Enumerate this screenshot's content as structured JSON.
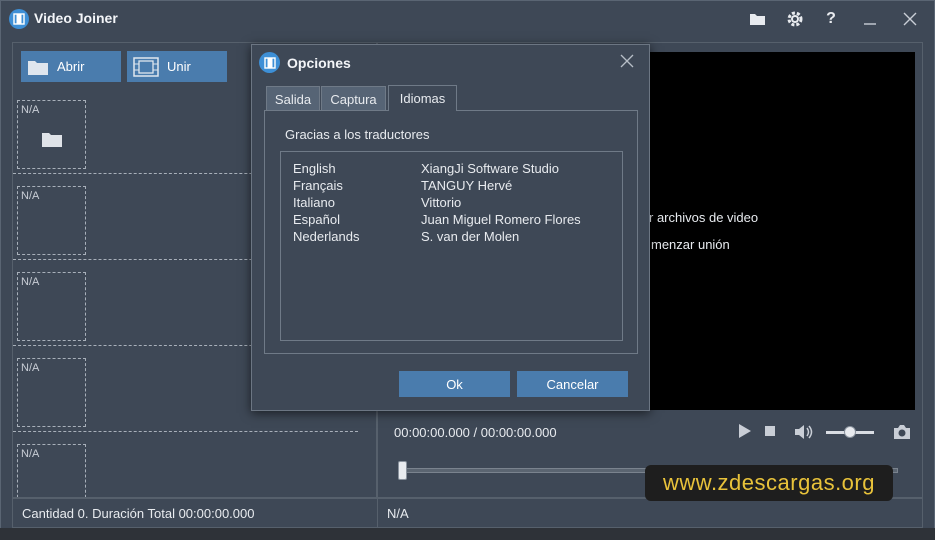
{
  "app": {
    "title": "Video Joiner",
    "icons": [
      "film-icon",
      "folder-icon",
      "gear-icon",
      "help-icon",
      "minimize-icon",
      "close-icon"
    ]
  },
  "toolbar": {
    "open_label": "Abrir",
    "join_label": "Unir"
  },
  "clips": [
    {
      "label": "N/A"
    },
    {
      "label": "N/A"
    },
    {
      "label": "N/A"
    },
    {
      "label": "N/A"
    },
    {
      "label": "N/A"
    }
  ],
  "preview": {
    "hint_1": "r archivos de video",
    "hint_2": "menzar unión",
    "time": "00:00:00.000 / 00:00:00.000",
    "volume": 0.5,
    "seek": 0
  },
  "status": {
    "summary": "Cantidad 0. Duración Total 00:00:00.000",
    "right": "N/A"
  },
  "dialog": {
    "title": "Opciones",
    "tabs": [
      {
        "label": "Salida",
        "active": false
      },
      {
        "label": "Captura",
        "active": false
      },
      {
        "label": "Idiomas",
        "active": true
      }
    ],
    "thanks": "Gracias a los traductores",
    "translators": [
      {
        "language": "English",
        "name": "XiangJi Software Studio"
      },
      {
        "language": "Français",
        "name": "TANGUY Hervé"
      },
      {
        "language": "Italiano",
        "name": "Vittorio"
      },
      {
        "language": "Español",
        "name": "Juan Miguel Romero Flores"
      },
      {
        "language": "Nederlands",
        "name": "S. van der Molen"
      }
    ],
    "ok_label": "Ok",
    "cancel_label": "Cancelar"
  },
  "watermark": "www.zdescargas.org",
  "colors": {
    "panel": "#3e4856",
    "button": "#4a7cad",
    "logo": "#3d8fd6",
    "watermark_text": "#e8c23a"
  }
}
